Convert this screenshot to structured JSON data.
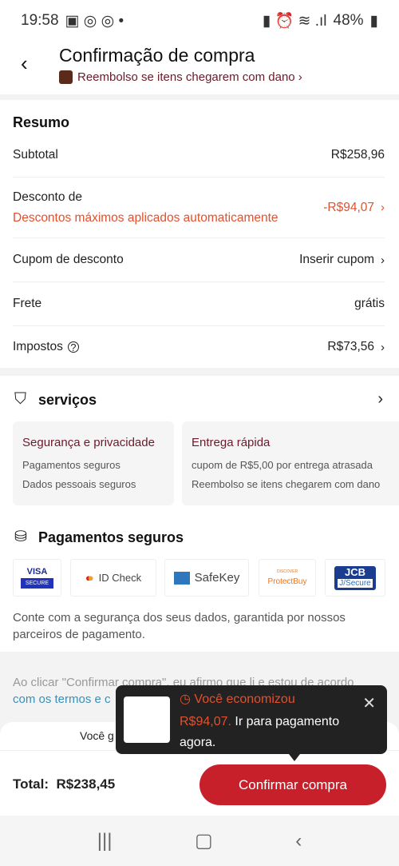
{
  "status": {
    "time": "19:58",
    "battery": "48%"
  },
  "header": {
    "title": "Confirmação de compra",
    "subtitle": "Reembolso se itens chegarem com dano ›"
  },
  "summary": {
    "title": "Resumo",
    "subtotal_label": "Subtotal",
    "subtotal": "R$258,96",
    "discount_label": "Desconto de",
    "discount_note": "Descontos máximos aplicados automaticamente",
    "discount": "-R$94,07",
    "coupon_label": "Cupom de desconto",
    "coupon_action": "Inserir cupom",
    "shipping_label": "Frete",
    "shipping": "grátis",
    "taxes_label": "Impostos",
    "taxes": "R$73,56"
  },
  "services": {
    "title": "serviços",
    "cards": [
      {
        "title": "Segurança e privacidade",
        "lines": [
          "Pagamentos seguros",
          "Dados pessoais seguros"
        ]
      },
      {
        "title": "Entrega rápida",
        "lines": [
          "cupom de R$5,00 por entrega atrasada",
          "Reembolso se itens chegarem com dano"
        ]
      }
    ]
  },
  "payments": {
    "title": "Pagamentos seguros",
    "logos": [
      "VISA",
      "SECURE",
      "ID Check",
      "SafeKey",
      "DISCOVER",
      "ProtectBuy",
      "JCB",
      "J/Secure"
    ],
    "note": "Conte com a segurança dos seus dados, garantida por nossos parceiros de pagamento."
  },
  "terms": {
    "text": "Ao clicar \"Confirmar compra\", eu afirmo que li e estou de acordo",
    "link": "com os termos e c"
  },
  "footer": {
    "credits": "Você g          5,04 créditos de compras",
    "total_label": "Total:",
    "total": "R$238,45",
    "confirm": "Confirmar compra"
  },
  "popup": {
    "title": "Você economizou",
    "amount": "R$94,07.",
    "text": " Ir para pagamento agora."
  },
  "colors": {
    "accent": "#c8202a",
    "discount": "#e0512f",
    "brand_dark": "#6b1a2a"
  }
}
